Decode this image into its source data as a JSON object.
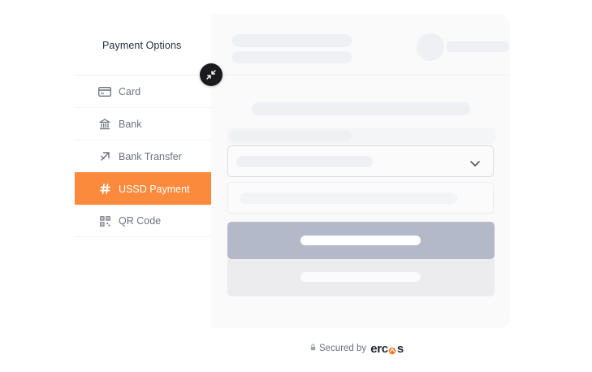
{
  "sidebar": {
    "title": "Payment Options",
    "items": [
      {
        "label": "Card",
        "icon": "credit-card-icon",
        "active": false
      },
      {
        "label": "Bank",
        "icon": "bank-icon",
        "active": false
      },
      {
        "label": "Bank Transfer",
        "icon": "transfer-arrow-icon",
        "active": false
      },
      {
        "label": "USSD Payment",
        "icon": "hash-icon",
        "active": true
      },
      {
        "label": "QR Code",
        "icon": "qr-code-icon",
        "active": false
      }
    ]
  },
  "footer": {
    "secured_text": "Secured by",
    "brand_prefix": "erc",
    "brand_suffix": "s"
  },
  "colors": {
    "accent": "#fb8a3c",
    "primary_button_loading": "#b3b9c9",
    "skeleton": "#eef0f4"
  }
}
